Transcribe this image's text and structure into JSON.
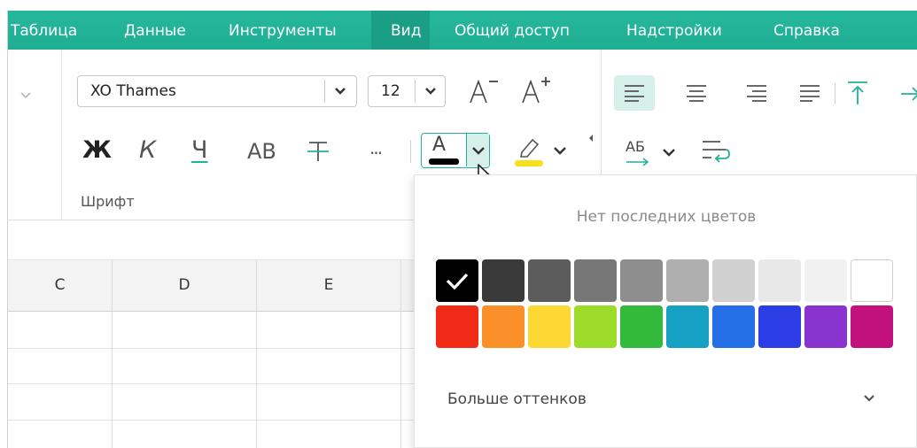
{
  "menu": {
    "items": [
      "Таблица",
      "Данные",
      "Инструменты",
      "Вид",
      "Общий доступ",
      "Надстройки",
      "Справка"
    ]
  },
  "font_group": {
    "font_name": "XO Thames",
    "font_size": "12",
    "bold_label": "Ж",
    "italic_label": "К",
    "underline_label": "Ч",
    "caps_label": "АВ",
    "more_label": "···",
    "font_color_glyph": "А",
    "group_label": "Шрифт"
  },
  "paragraph_group": {
    "direction_glyph": "АБ"
  },
  "sheet": {
    "columns": [
      "C",
      "D",
      "E"
    ]
  },
  "color_popup": {
    "recent_label": "Нет последних цветов",
    "more_label": "Больше оттенков",
    "selected_color": "#000000",
    "row1": [
      "#000000",
      "#3a3a3a",
      "#5c5c5c",
      "#777777",
      "#8e8e8e",
      "#afafaf",
      "#d0d0d0",
      "#e8e8e8",
      "#f1f1f1",
      "#ffffff"
    ],
    "row2": [
      "#f22a18",
      "#fb8f29",
      "#fdd835",
      "#9ddb2a",
      "#33b93c",
      "#16a0c2",
      "#246ee6",
      "#2d3de6",
      "#8a34cf",
      "#c2117c"
    ]
  },
  "colors": {
    "menu_bg": "#21b298",
    "accent": "#21b298",
    "font_color_bar": "#000000",
    "highlight_bar": "#f7e11d"
  }
}
